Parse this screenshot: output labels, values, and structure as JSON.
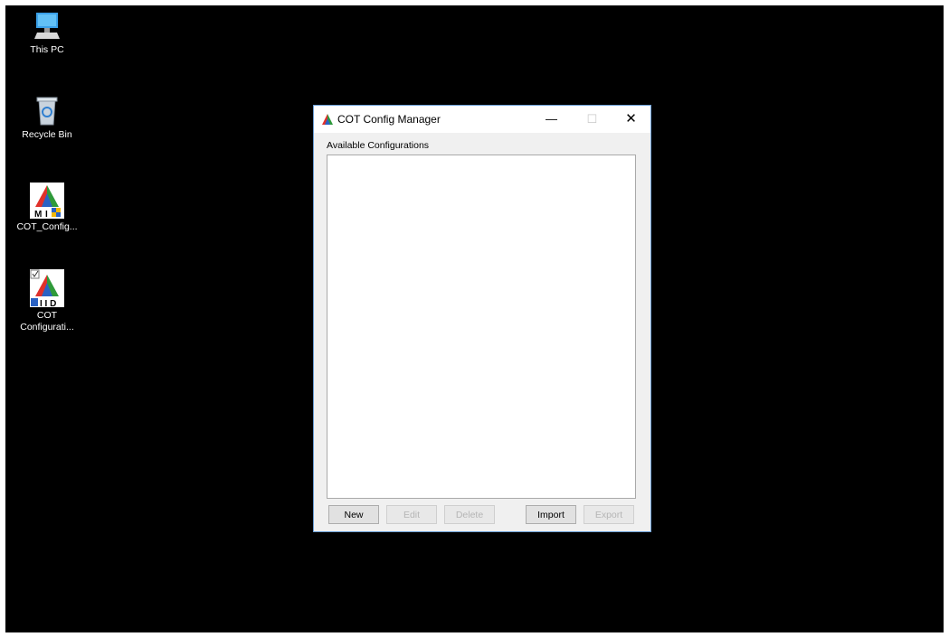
{
  "desktop": {
    "icons": [
      {
        "label": "This PC",
        "icon": "computer-icon"
      },
      {
        "label": "Recycle Bin",
        "icon": "recycle-bin-icon"
      },
      {
        "label": "COT_Config...",
        "icon": "mid-app-icon"
      },
      {
        "label": "COT Configurati...",
        "icon": "mid-shortcut-icon"
      }
    ]
  },
  "window": {
    "title": "COT Config Manager",
    "controls": {
      "minimize": "—",
      "maximize": "☐",
      "close": "✕"
    },
    "group_label": "Available Configurations",
    "configurations": [],
    "buttons": {
      "new": "New",
      "edit": "Edit",
      "delete": "Delete",
      "import": "Import",
      "export": "Export"
    }
  },
  "colors": {
    "desktop_bg": "#000000",
    "window_bg": "#f0f0f0",
    "window_border": "#6c9fd6"
  }
}
